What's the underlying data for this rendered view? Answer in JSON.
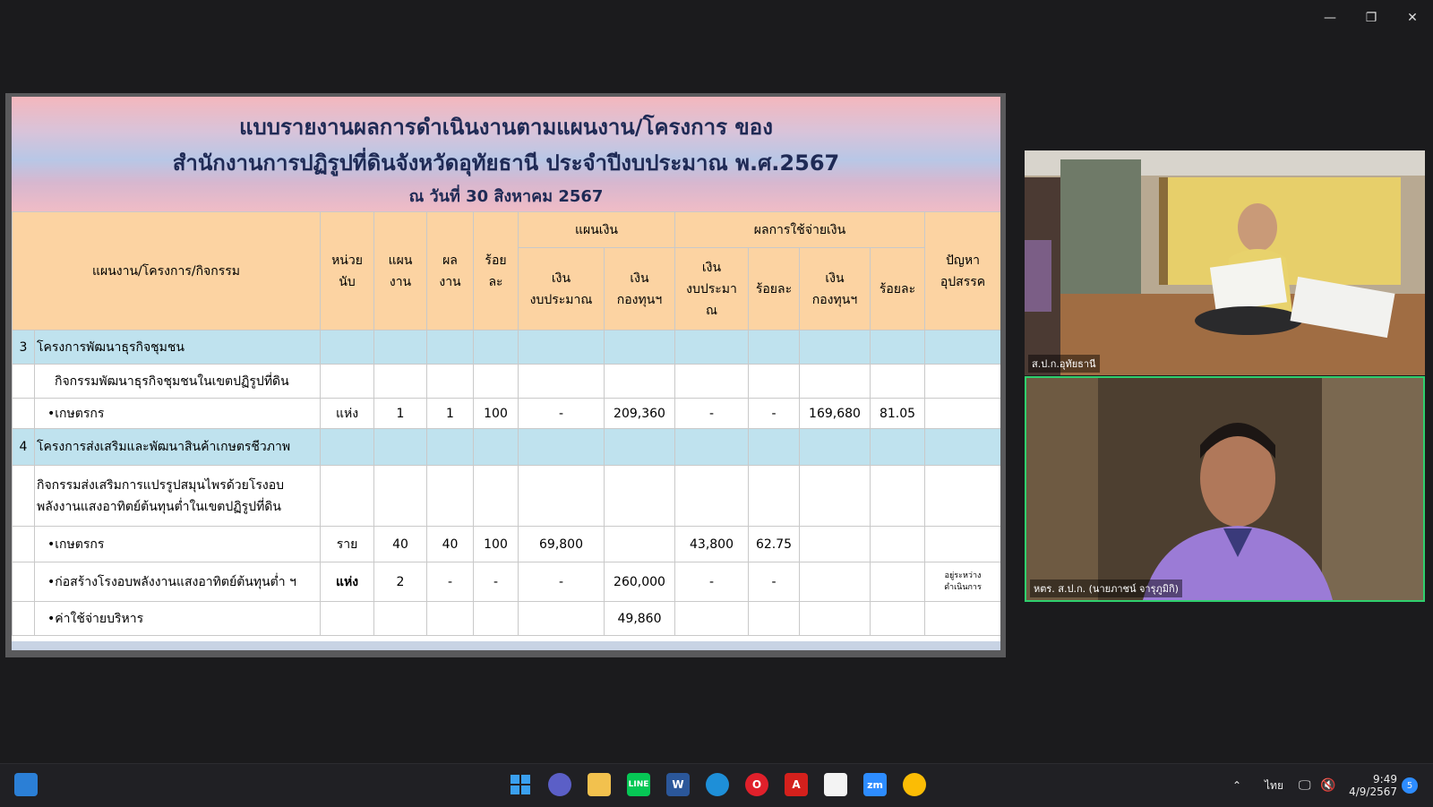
{
  "window_controls": {
    "minimize": "—",
    "restore": "❐",
    "close": "✕"
  },
  "slide": {
    "title1": "แบบรายงานผลการดำเนินงานตามแผนงาน/โครงการ ของ",
    "title2": "สำนักงานการปฏิรูปที่ดินจังหวัดอุทัยธานี ประจำปีงบประมาณ พ.ศ.2567",
    "title3": "ณ วันที่ 30 สิงหาคม 2567",
    "headers": {
      "activity": "แผนงาน/โครงการ/กิจกรรม",
      "unit": [
        "หน่วย",
        "นับ"
      ],
      "plan": [
        "แผน",
        "งาน"
      ],
      "result": [
        "ผล",
        "งาน"
      ],
      "percent": [
        "ร้อย",
        "ละ"
      ],
      "money_plan": "แผนเงิน",
      "spending": "ผลการใช้จ่ายเงิน",
      "problem": [
        "ปัญหา",
        "อุปสรรค"
      ],
      "budget": [
        "เงิน",
        "งบประมาณ"
      ],
      "fund": [
        "เงิน",
        "กองทุนฯ"
      ],
      "budget2": [
        "เงิน",
        "งบประมา",
        "ณ"
      ],
      "pct2": "ร้อยละ",
      "fund2": [
        "เงิน",
        "กองทุนฯ"
      ],
      "pct3": "ร้อยละ"
    },
    "rows": [
      {
        "no": "3",
        "name": "โครงการพัฒนาธุรกิจชุมชน",
        "type": "section"
      },
      {
        "name": "กิจกรรมพัฒนาธุรกิจชุมชนในเขตปฏิรูปที่ดิน",
        "type": "activity"
      },
      {
        "name": "เกษตรกร",
        "unit": "แห่ง",
        "plan": "1",
        "result": "1",
        "percent": "100",
        "budget": "-",
        "fund": "209,360",
        "spent_budget": "-",
        "spent_budget_pct": "-",
        "spent_fund": "169,680",
        "spent_fund_pct": "81.05",
        "problem": "",
        "type": "item"
      },
      {
        "no": "4",
        "name": "โครงการส่งเสริมและพัฒนาสินค้าเกษตรชีวภาพ",
        "type": "section"
      },
      {
        "name1": "กิจกรรมส่งเสริมการแปรรูปสมุนไพรด้วยโรงอบ",
        "name2": "พลังงานแสงอาทิตย์ต้นทุนต่ำในเขตปฏิรูปที่ดิน",
        "type": "activity2"
      },
      {
        "name": "เกษตรกร",
        "unit": "ราย",
        "plan": "40",
        "result": "40",
        "percent": "100",
        "budget": "69,800",
        "fund": "",
        "spent_budget": "43,800",
        "spent_budget_pct": "62.75",
        "spent_fund": "",
        "spent_fund_pct": "",
        "problem": "",
        "type": "item"
      },
      {
        "name": "ก่อสร้างโรงอบพลังงานแสงอาทิตย์ต้นทุนต่ำ ฯ",
        "unit": "แห่ง",
        "plan": "2",
        "result": "-",
        "percent": "-",
        "budget": "-",
        "fund": "260,000",
        "spent_budget": "-",
        "spent_budget_pct": "-",
        "spent_fund": "",
        "spent_fund_pct": "",
        "problem1": "อยู่ระหว่าง",
        "problem2": "ดำเนินการ",
        "type": "item2"
      },
      {
        "name": "ค่าใช้จ่ายบริหาร",
        "unit": "",
        "plan": "",
        "result": "",
        "percent": "",
        "budget": "",
        "fund": "49,860",
        "spent_budget": "",
        "spent_budget_pct": "",
        "spent_fund": "",
        "spent_fund_pct": "",
        "problem": "",
        "type": "item"
      }
    ]
  },
  "participants": [
    {
      "label": "ส.ป.ก.อุทัยธานี"
    },
    {
      "label": "หตร. ส.ป.ก. (นายภาชน์ จารุภูมิกิ)"
    }
  ],
  "taskbar": {
    "apps": [
      "windows-start",
      "teams-chat",
      "file-explorer",
      "line",
      "word",
      "edge",
      "opera",
      "acrobat",
      "notepad",
      "zoom",
      "chrome"
    ],
    "language": "ไทย",
    "time": "9:49",
    "date": "4/9/2567",
    "notification_count": "5"
  }
}
